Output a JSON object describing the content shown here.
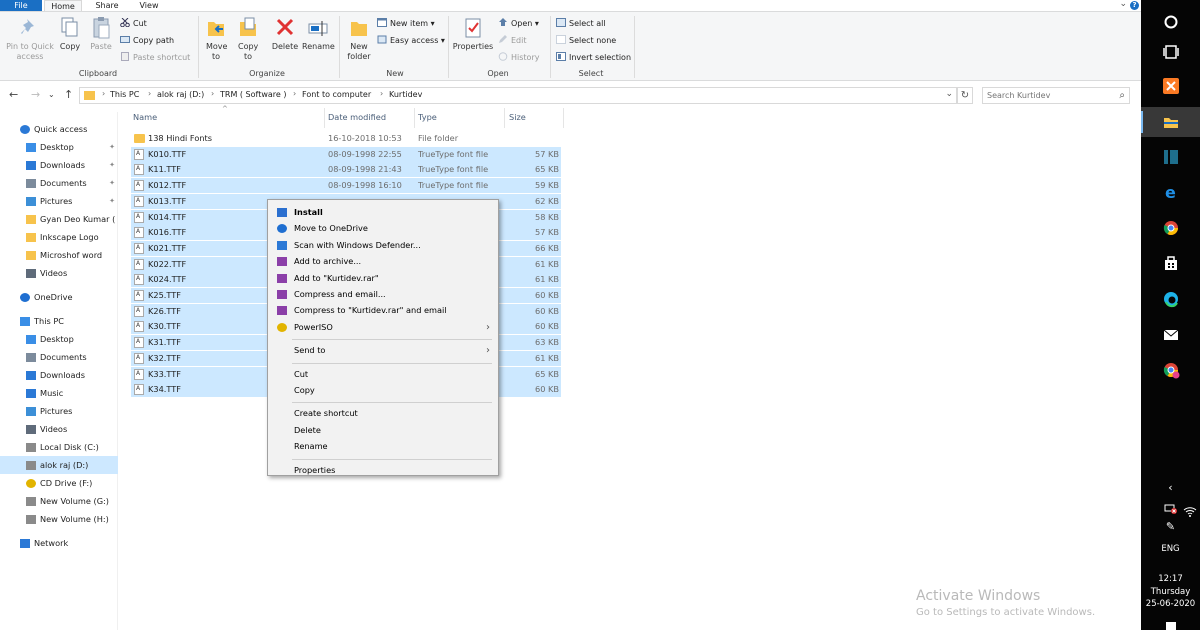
{
  "ribbon": {
    "tabs": [
      "File",
      "Home",
      "Share",
      "View"
    ],
    "clipboard": {
      "label": "Clipboard",
      "pin": "Pin to Quick access",
      "copy": "Copy",
      "paste": "Paste",
      "cut": "Cut",
      "copy_path": "Copy path",
      "paste_shortcut": "Paste shortcut"
    },
    "organize": {
      "label": "Organize",
      "move_to": "Move to",
      "copy_to": "Copy to",
      "delete": "Delete",
      "rename": "Rename"
    },
    "new": {
      "label": "New",
      "new_folder": "New folder",
      "new_item": "New item",
      "easy_access": "Easy access"
    },
    "open": {
      "label": "Open",
      "properties": "Properties",
      "open": "Open",
      "edit": "Edit",
      "history": "History"
    },
    "select": {
      "label": "Select",
      "select_all": "Select all",
      "select_none": "Select none",
      "invert_selection": "Invert selection"
    }
  },
  "address": {
    "crumbs": [
      "This PC",
      "alok raj (D:)",
      "TRM ( Software )",
      "Font to computer",
      "Kurtidev"
    ],
    "search_placeholder": "Search Kurtidev"
  },
  "nav": [
    {
      "label": "Quick access",
      "icon": "star-icon",
      "color": "#2b79d6",
      "pinned": false
    },
    {
      "label": "Desktop",
      "icon": "desktop-icon",
      "color": "#3a8ee6",
      "pinned": true
    },
    {
      "label": "Downloads",
      "icon": "download-icon",
      "color": "#2b79d6",
      "pinned": true
    },
    {
      "label": "Documents",
      "icon": "documents-icon",
      "color": "#7c8b9c",
      "pinned": true
    },
    {
      "label": "Pictures",
      "icon": "pictures-icon",
      "color": "#3c8fd7",
      "pinned": true
    },
    {
      "label": "Gyan Deo Kumar ( F",
      "icon": "folder-icon",
      "color": "#f7c34c",
      "pinned": false
    },
    {
      "label": "Inkscape Logo",
      "icon": "folder-icon",
      "color": "#f7c34c",
      "pinned": false
    },
    {
      "label": "Microshof word",
      "icon": "folder-icon",
      "color": "#f7c34c",
      "pinned": false
    },
    {
      "label": "Videos",
      "icon": "videos-icon",
      "color": "#5f6b7a",
      "pinned": false
    },
    {
      "label": "OneDrive",
      "icon": "onedrive-icon",
      "color": "#1f6fd1",
      "pinned": false
    },
    {
      "label": "This PC",
      "icon": "pc-icon",
      "color": "#3a8ee6",
      "pinned": false
    },
    {
      "label": "Desktop",
      "icon": "desktop-icon",
      "color": "#3a8ee6",
      "pinned": false
    },
    {
      "label": "Documents",
      "icon": "documents-icon",
      "color": "#7c8b9c",
      "pinned": false
    },
    {
      "label": "Downloads",
      "icon": "download-icon",
      "color": "#2b79d6",
      "pinned": false
    },
    {
      "label": "Music",
      "icon": "music-icon",
      "color": "#2b79d6",
      "pinned": false
    },
    {
      "label": "Pictures",
      "icon": "pictures-icon",
      "color": "#3c8fd7",
      "pinned": false
    },
    {
      "label": "Videos",
      "icon": "videos-icon",
      "color": "#5f6b7a",
      "pinned": false
    },
    {
      "label": "Local Disk (C:)",
      "icon": "disk-icon",
      "color": "#8a8a8a",
      "pinned": false
    },
    {
      "label": "alok raj (D:)",
      "icon": "disk-icon",
      "color": "#8a8a8a",
      "pinned": false,
      "selected": true
    },
    {
      "label": "CD Drive (F:)",
      "icon": "cd-icon",
      "color": "#e2b400",
      "pinned": false
    },
    {
      "label": "New Volume (G:)",
      "icon": "disk-icon",
      "color": "#8a8a8a",
      "pinned": false
    },
    {
      "label": "New Volume (H:)",
      "icon": "disk-icon",
      "color": "#8a8a8a",
      "pinned": false
    },
    {
      "label": "Network",
      "icon": "network-icon",
      "color": "#2b79d6",
      "pinned": false
    }
  ],
  "columns": {
    "name": "Name",
    "date": "Date modified",
    "type": "Type",
    "size": "Size"
  },
  "files": [
    {
      "name": "138 Hindi Fonts",
      "date": "16-10-2018 10:53",
      "type": "File folder",
      "size": "",
      "folder": true,
      "selected": false
    },
    {
      "name": "K010.TTF",
      "date": "08-09-1998 22:55",
      "type": "TrueType font file",
      "size": "57 KB",
      "selected": true
    },
    {
      "name": "K11.TTF",
      "date": "08-09-1998 21:43",
      "type": "TrueType font file",
      "size": "65 KB",
      "selected": true
    },
    {
      "name": "K012.TTF",
      "date": "08-09-1998 16:10",
      "type": "TrueType font file",
      "size": "59 KB",
      "selected": true
    },
    {
      "name": "K013.TTF",
      "date": "",
      "type": "",
      "size": "62 KB",
      "selected": true
    },
    {
      "name": "K014.TTF",
      "date": "",
      "type": "",
      "size": "58 KB",
      "selected": true
    },
    {
      "name": "K016.TTF",
      "date": "",
      "type": "",
      "size": "57 KB",
      "selected": true
    },
    {
      "name": "K021.TTF",
      "date": "",
      "type": "",
      "size": "66 KB",
      "selected": true
    },
    {
      "name": "K022.TTF",
      "date": "",
      "type": "",
      "size": "61 KB",
      "selected": true
    },
    {
      "name": "K024.TTF",
      "date": "",
      "type": "",
      "size": "61 KB",
      "selected": true
    },
    {
      "name": "K25.TTF",
      "date": "",
      "type": "",
      "size": "60 KB",
      "selected": true
    },
    {
      "name": "K26.TTF",
      "date": "",
      "type": "",
      "size": "60 KB",
      "selected": true
    },
    {
      "name": "K30.TTF",
      "date": "",
      "type": "",
      "size": "60 KB",
      "selected": true
    },
    {
      "name": "K31.TTF",
      "date": "",
      "type": "",
      "size": "63 KB",
      "selected": true
    },
    {
      "name": "K32.TTF",
      "date": "",
      "type": "",
      "size": "61 KB",
      "selected": true
    },
    {
      "name": "K33.TTF",
      "date": "",
      "type": "",
      "size": "65 KB",
      "selected": true
    },
    {
      "name": "K34.TTF",
      "date": "",
      "type": "",
      "size": "60 KB",
      "selected": true
    }
  ],
  "context_menu": [
    {
      "label": "Install",
      "icon": "shield-icon",
      "bold": true
    },
    {
      "label": "Move to OneDrive",
      "icon": "onedrive-icon"
    },
    {
      "label": "Scan with Windows Defender...",
      "icon": "defender-icon"
    },
    {
      "label": "Add to archive...",
      "icon": "winrar-icon"
    },
    {
      "label": "Add to \"Kurtidev.rar\"",
      "icon": "winrar-icon"
    },
    {
      "label": "Compress and email...",
      "icon": "winrar-icon"
    },
    {
      "label": "Compress to \"Kurtidev.rar\" and email",
      "icon": "winrar-icon"
    },
    {
      "label": "PowerISO",
      "icon": "poweriso-icon",
      "submenu": true
    },
    {
      "label": "Send to",
      "submenu": true,
      "sep_before": true
    },
    {
      "label": "Cut",
      "sep_before": true
    },
    {
      "label": "Copy"
    },
    {
      "label": "Create shortcut",
      "sep_before": true
    },
    {
      "label": "Delete"
    },
    {
      "label": "Rename"
    },
    {
      "label": "Properties",
      "sep_before": true
    }
  ],
  "watermark": {
    "title": "Activate Windows",
    "subtitle": "Go to Settings to activate Windows."
  },
  "taskbar": {
    "time": "12:17",
    "day": "Thursday",
    "date": "25-06-2020",
    "lang": "ENG"
  },
  "colors": {
    "accent": "#1a6fc4",
    "selection": "#cce8ff",
    "taskbar": "#050505"
  }
}
